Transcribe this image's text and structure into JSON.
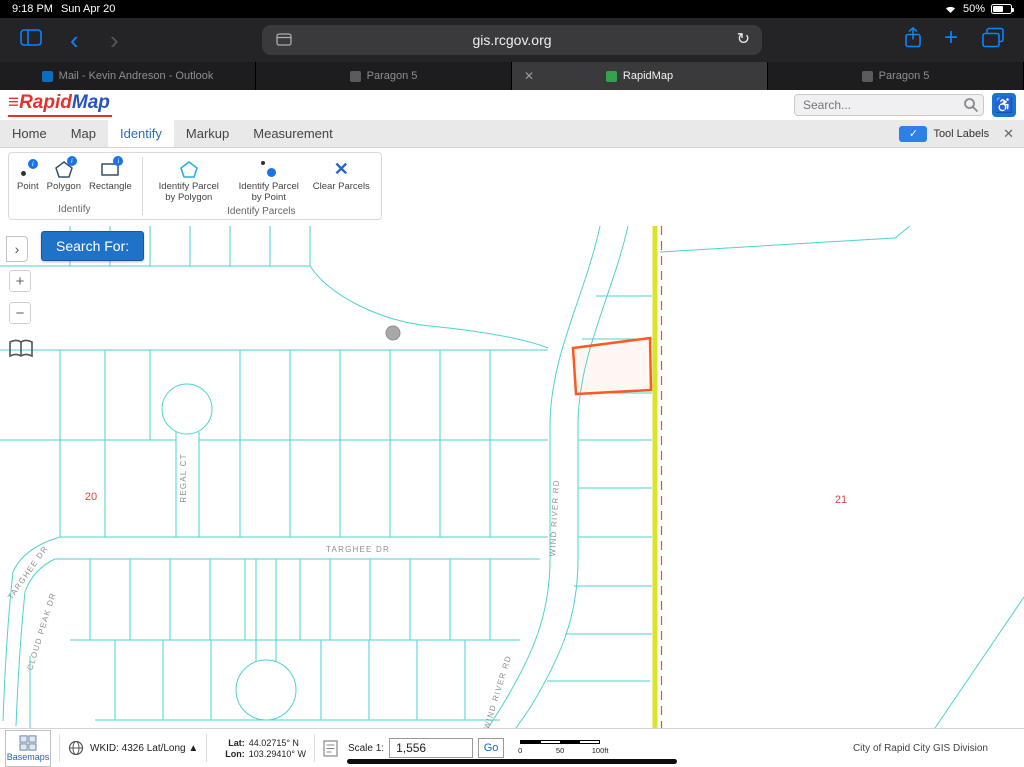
{
  "status_bar": {
    "time": "9:18 PM",
    "date": "Sun Apr 20",
    "battery_percent": "50%"
  },
  "browser": {
    "url": "gis.rcgov.org",
    "tabs": [
      {
        "label": "Mail - Kevin Andreson - Outlook"
      },
      {
        "label": "Paragon 5"
      },
      {
        "label": "RapidMap"
      },
      {
        "label": "Paragon 5"
      }
    ]
  },
  "icons": {
    "close": "✕",
    "back": "‹",
    "forward": "›",
    "reload": "↻",
    "new_tab": "+",
    "expand": "›",
    "zoom_in": "+",
    "zoom_out": "−",
    "check": "✓",
    "wheelchair": "♿"
  },
  "header": {
    "logo_rapid": "≡Rapid",
    "logo_map": "Map",
    "search_placeholder": "Search..."
  },
  "menu": {
    "items": [
      {
        "label": "Home"
      },
      {
        "label": "Map"
      },
      {
        "label": "Identify"
      },
      {
        "label": "Markup"
      },
      {
        "label": "Measurement"
      }
    ],
    "tool_labels": "Tool Labels"
  },
  "ribbon": {
    "groups": [
      {
        "label": "Identify",
        "tools": [
          {
            "label": "Point"
          },
          {
            "label": "Polygon"
          },
          {
            "label": "Rectangle"
          }
        ]
      },
      {
        "label": "Identify Parcels",
        "tools": [
          {
            "label": "Identify Parcel by Polygon"
          },
          {
            "label": "Identify Parcel by Point"
          },
          {
            "label": "Clear Parcels"
          }
        ]
      }
    ]
  },
  "map": {
    "search_for": "Search For:",
    "streets": {
      "regal_ct": "REGAL CT",
      "targhee_dr": "TARGHEE DR",
      "targhee_dr_west": "TARGHEE DR",
      "cloud_peak_dr": "CLOUD PEAK DR",
      "wind_river_rd": "WIND RIVER RD",
      "wind_river_rd_south": "WIND RIVER RD"
    },
    "sections": {
      "left": "20",
      "right": "21"
    }
  },
  "bottom_bar": {
    "basemaps": "Basemaps",
    "wkid": "WKID: 4326 Lat/Long ▲",
    "lat_label": "Lat:",
    "lat_value": "44.02715° N",
    "lon_label": "Lon:",
    "lon_value": "103.29410° W",
    "scale_label": "Scale 1:",
    "scale_value": "1,556",
    "go": "Go",
    "scalebar": {
      "zero": "0",
      "fifty": "50",
      "hundred": "100ft"
    },
    "attribution": "City of Rapid City GIS Division"
  },
  "colors": {
    "ios_accent": "#0a84ff",
    "app_blue": "#1f72c8",
    "parcel_cyan": "#21c7c7",
    "boundary_yellow": "#dde427",
    "boundary_red": "#ff4136",
    "selected_parcel_orange": "#ff5a1e",
    "section_red": "#e04343"
  }
}
